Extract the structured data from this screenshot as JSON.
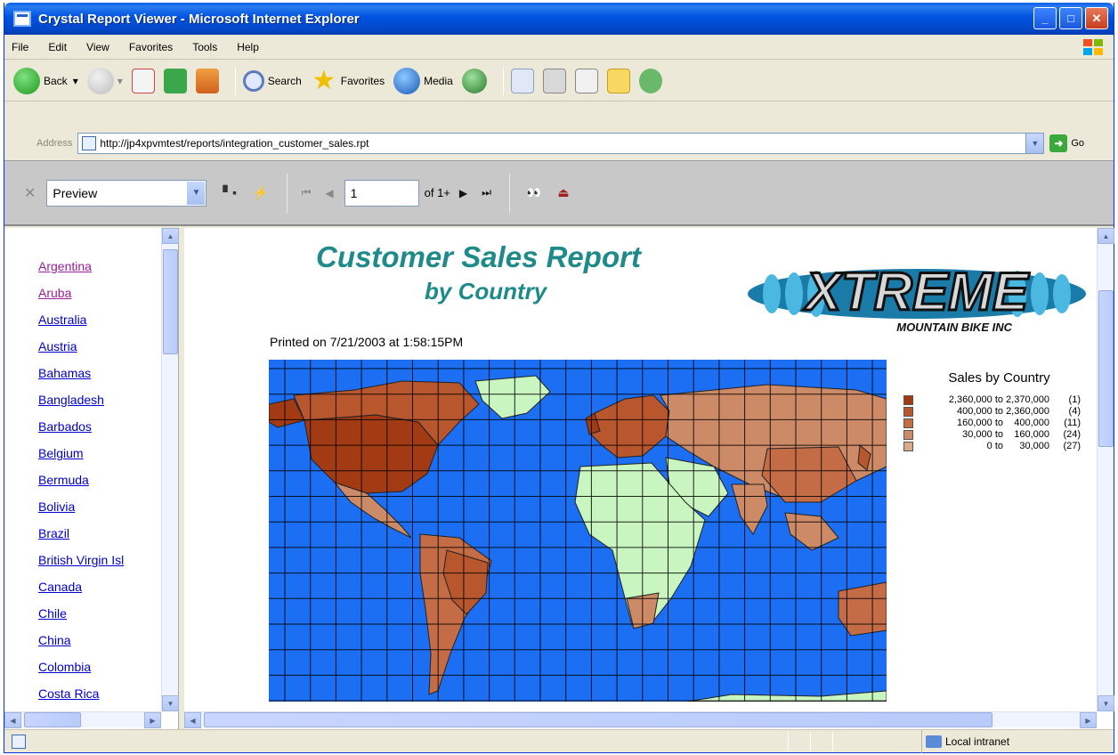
{
  "window": {
    "title": "Crystal Report Viewer - Microsoft Internet Explorer"
  },
  "menu": [
    "File",
    "Edit",
    "View",
    "Favorites",
    "Tools",
    "Help"
  ],
  "toolbar": {
    "back": "Back",
    "search": "Search",
    "favorites": "Favorites",
    "media": "Media"
  },
  "address": {
    "label": "Address",
    "url": "http://jp4xpvmtest/reports/integration_customer_sales.rpt",
    "go": "Go"
  },
  "viewer": {
    "view_mode": "Preview",
    "page_number": "1",
    "page_of": "of 1+"
  },
  "countries": [
    {
      "label": "Argentina",
      "visited": true
    },
    {
      "label": "Aruba",
      "visited": true
    },
    {
      "label": "Australia",
      "visited": false
    },
    {
      "label": "Austria",
      "visited": false
    },
    {
      "label": "Bahamas",
      "visited": false
    },
    {
      "label": "Bangladesh",
      "visited": false
    },
    {
      "label": "Barbados",
      "visited": false
    },
    {
      "label": "Belgium",
      "visited": false
    },
    {
      "label": "Bermuda",
      "visited": false
    },
    {
      "label": "Bolivia",
      "visited": false
    },
    {
      "label": "Brazil",
      "visited": false
    },
    {
      "label": "British Virgin Isl",
      "visited": false
    },
    {
      "label": "Canada",
      "visited": false
    },
    {
      "label": "Chile",
      "visited": false
    },
    {
      "label": "China",
      "visited": false
    },
    {
      "label": "Colombia",
      "visited": false
    },
    {
      "label": "Costa Rica",
      "visited": false
    }
  ],
  "report": {
    "title": "Customer Sales Report",
    "subtitle": "by Country",
    "printed": "Printed on 7/21/2003 at 1:58:15PM",
    "logo_main": "XTREME",
    "logo_sub": "MOUNTAIN BIKE INC"
  },
  "legend": {
    "title": "Sales by Country",
    "rows": [
      {
        "range": "2,360,000 to 2,370,000",
        "count": "(1)",
        "color": "#a23a14"
      },
      {
        "range": "400,000 to 2,360,000",
        "count": "(4)",
        "color": "#b8562e"
      },
      {
        "range": "160,000 to    400,000",
        "count": "(11)",
        "color": "#c46c46"
      },
      {
        "range": "30,000 to    160,000",
        "count": "(24)",
        "color": "#cc8a66"
      },
      {
        "range": "0 to      30,000",
        "count": "(27)",
        "color": "#d8aa8a"
      }
    ]
  },
  "map_colors": {
    "ocean": "#1c6ef2",
    "none": "#c8f5c0"
  },
  "status": {
    "zone": "Local intranet"
  }
}
